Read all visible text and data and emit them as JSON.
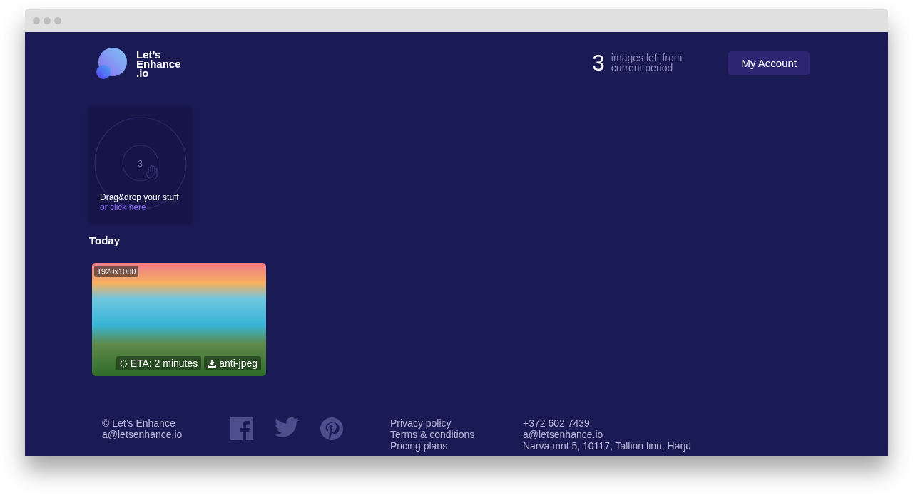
{
  "header": {
    "logo_text": [
      "Let’s",
      "Enhance",
      ".io"
    ],
    "images_left_count": "3",
    "images_left_label": [
      "images left from",
      "current period"
    ],
    "account_button": "My Account"
  },
  "dropzone": {
    "count": "3",
    "title": "Drag&drop your stuff",
    "link": "or click here"
  },
  "section_title": "Today",
  "images": [
    {
      "resolution": "1920x1080",
      "eta": "ETA: 2 minutes",
      "mode": "anti-jpeg"
    }
  ],
  "footer": {
    "company": [
      "© Let’s Enhance",
      "a@letsenhance.io"
    ],
    "links": [
      "Privacy policy",
      "Terms & conditions",
      "Pricing plans"
    ],
    "contact": [
      "+372 602 7439",
      "a@letsenhance.io",
      "Narva mnt 5, 10117, Tallinn linn, Harju"
    ]
  }
}
